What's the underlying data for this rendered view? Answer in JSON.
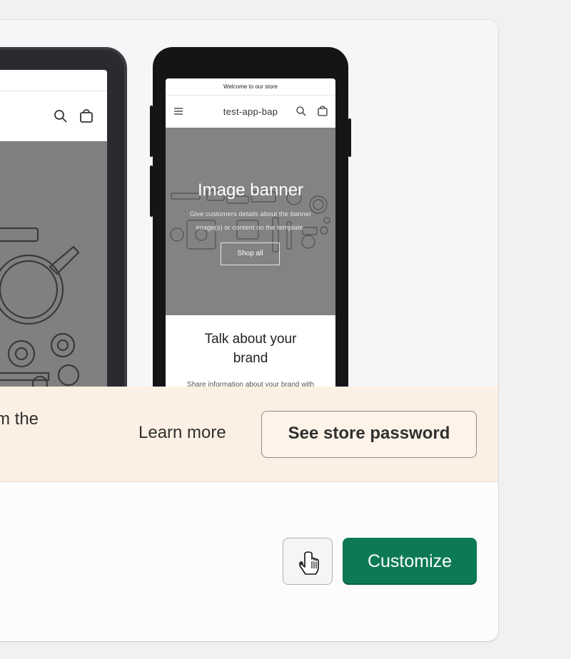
{
  "preview": {
    "phone": {
      "announcement": "Welcome to our store",
      "store_name": "test-app-bap",
      "banner_title": "Image banner",
      "banner_text": "Give customers details about the banner image(s) or content on the template.",
      "banner_button": "Shop all",
      "brand_title_line1": "Talk about your",
      "brand_title_line2": "brand",
      "brand_text": "Share information about your brand with"
    }
  },
  "notice": {
    "text_fragment": "m the",
    "learn_more": "Learn more",
    "see_password": "See store password"
  },
  "footer": {
    "customize": "Customize"
  },
  "colors": {
    "primary": "#0d7a55",
    "notice_bg": "#fcf0e4",
    "banner_gray": "#848384"
  }
}
